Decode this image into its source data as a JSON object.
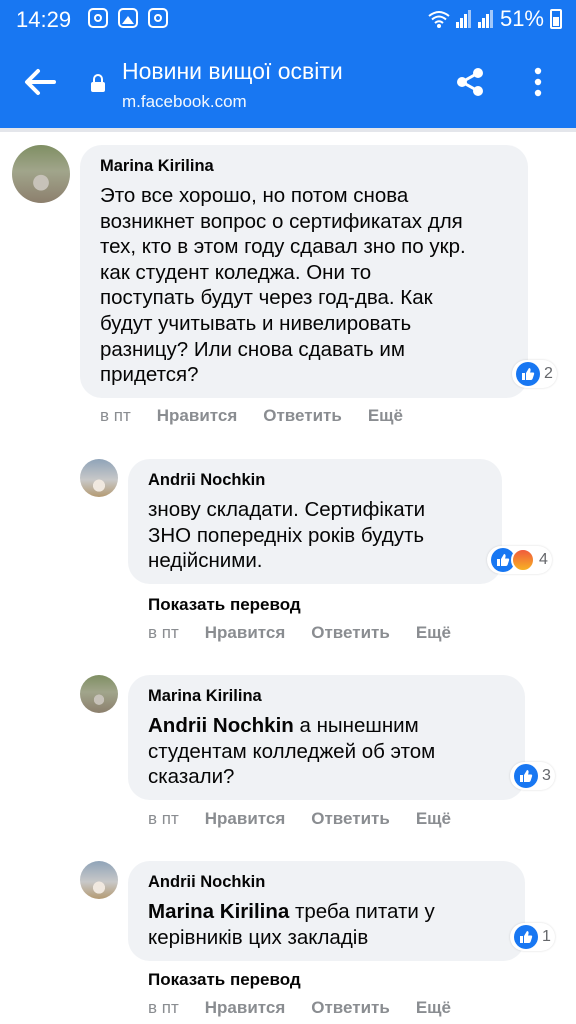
{
  "status_bar": {
    "time": "14:29",
    "battery": "51%",
    "left_icons": [
      "instagram-icon",
      "gallery-icon",
      "instagram-icon"
    ]
  },
  "header": {
    "title": "Новини вищої освіти",
    "url": "m.facebook.com"
  },
  "colors": {
    "brand": "#1877f2",
    "bubble": "#f0f2f5",
    "meta_text": "#8a8d91"
  },
  "comments": [
    {
      "author": "Marina Kirilina",
      "text_lines": [
        "Это все хорошо, но потом снова",
        "возникнет вопрос о сертификатах для",
        "тех, кто в этом году сдавал зно по укр.",
        "как студент коледжа. Они то",
        "поступать будут через год-два. Как",
        "будут учитывать и нивелировать",
        "разницу? Или снова сдавать им",
        "придется?"
      ],
      "reaction_count": "2",
      "time": "в пт",
      "like": "Нравится",
      "reply": "Ответить",
      "more": "Ещё"
    },
    {
      "author": "Andrii Nochkin",
      "text_lines": [
        "знову складати. Сертифікати",
        "ЗНО попередніх років будуть",
        "недійсними."
      ],
      "reaction_count": "4",
      "translate": "Показать перевод",
      "time": "в пт",
      "like": "Нравится",
      "reply": "Ответить",
      "more": "Ещё"
    },
    {
      "author": "Marina Kirilina",
      "mention": "Andrii Nochkin",
      "text_lines": [
        " а нынешним",
        "студентам колледжей об этом",
        "сказали?"
      ],
      "reaction_count": "3",
      "time": "в пт",
      "like": "Нравится",
      "reply": "Ответить",
      "more": "Ещё"
    },
    {
      "author": "Andrii Nochkin",
      "mention": "Marina Kirilina",
      "text_lines": [
        " треба питати у",
        "керівників цих закладів"
      ],
      "reaction_count": "1",
      "translate": "Показать перевод",
      "time": "в пт",
      "like": "Нравится",
      "reply": "Ответить",
      "more": "Ещё"
    }
  ]
}
